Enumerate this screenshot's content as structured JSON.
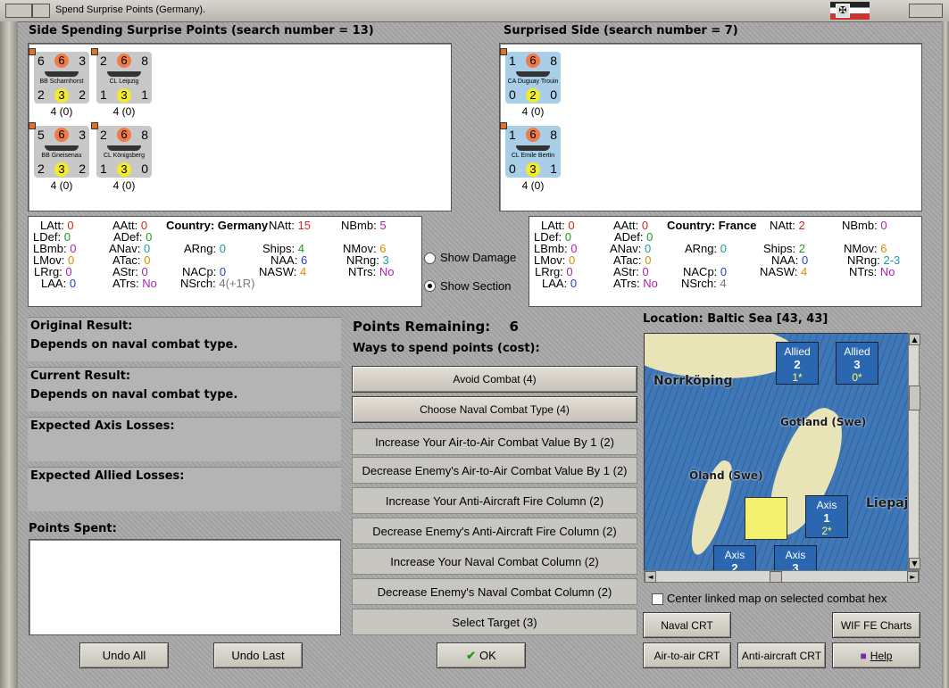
{
  "window": {
    "title": "Spend Surprise Points (Germany)."
  },
  "left_side": {
    "header": "Side Spending Surprise Points (search number = 13)",
    "counters": [
      {
        "name": "BB Scharnhorst",
        "tl": "6",
        "tc": "6",
        "tr": "3",
        "bl": "2",
        "bc": "3",
        "br": "2",
        "caption": "4 (0)"
      },
      {
        "name": "CL Leipzig",
        "tl": "2",
        "tc": "6",
        "tr": "8",
        "bl": "1",
        "bc": "3",
        "br": "1",
        "caption": "4 (0)"
      },
      {
        "name": "BB Gneisenau",
        "tl": "5",
        "tc": "6",
        "tr": "3",
        "bl": "2",
        "bc": "3",
        "br": "2",
        "caption": "4 (0)"
      },
      {
        "name": "CL Königsberg",
        "tl": "2",
        "tc": "6",
        "tr": "8",
        "bl": "1",
        "bc": "3",
        "br": "0",
        "caption": "4 (0)"
      }
    ]
  },
  "right_side": {
    "header": "Surprised Side (search number = 7)",
    "counters": [
      {
        "name": "CA Duguay Trouin",
        "tl": "1",
        "tc": "6",
        "tr": "8",
        "bl": "0",
        "bc": "2",
        "br": "0",
        "caption": "4 (0)"
      },
      {
        "name": "CL Emile Bertin",
        "tl": "1",
        "tc": "6",
        "tr": "8",
        "bl": "0",
        "bc": "3",
        "br": "1",
        "caption": "4 (0)"
      }
    ]
  },
  "stats_left": {
    "country_label": "Country:",
    "country": "Germany",
    "rows": [
      [
        "LAtt:",
        "0",
        "AAtt:",
        "0",
        "NAtt:",
        "15",
        "NBmb:",
        "5"
      ],
      [
        "LDef:",
        "0",
        "ADef:",
        "0",
        "",
        "",
        "",
        ""
      ],
      [
        "LBmb:",
        "0",
        "ANav:",
        "0",
        "ARng:",
        "0",
        "Ships:",
        "4",
        "NMov:",
        "6"
      ],
      [
        "LMov:",
        "0",
        "ATac:",
        "0",
        "NAA:",
        "6",
        "NRng:",
        "3"
      ],
      [
        "LRrg:",
        "0",
        "AStr:",
        "0",
        "NACp:",
        "0",
        "NASW:",
        "4",
        "NTrs:",
        "No"
      ],
      [
        "LAA:",
        "0",
        "ATrs:",
        "No",
        "NSrch:",
        "4(+1R)"
      ]
    ]
  },
  "stats_right": {
    "country_label": "Country:",
    "country": "France",
    "values": {
      "LAtt": "0",
      "AAtt": "0",
      "NAtt": "2",
      "NBmb": "0",
      "LDef": "0",
      "ADef": "0",
      "LBmb": "0",
      "ANav": "0",
      "ARng": "0",
      "Ships": "2",
      "NMov": "6",
      "LMov": "0",
      "ATac": "0",
      "NAA": "0",
      "NRng": "2-3",
      "LRrg": "0",
      "AStr": "0",
      "NACp": "0",
      "NASW": "4",
      "NTrs": "No",
      "LAA": "0",
      "ATrs": "No",
      "NSrch": "4"
    }
  },
  "options": {
    "show_damage": "Show Damage",
    "show_section": "Show Section"
  },
  "results": {
    "original_label": "Original Result:",
    "original_value": "Depends on naval combat type.",
    "current_label": "Current Result:",
    "current_value": "Depends on naval combat type.",
    "axis_losses": "Expected Axis Losses:",
    "allied_losses": "Expected Allied Losses:",
    "points_spent": "Points Spent:"
  },
  "spend": {
    "points_label": "Points Remaining:",
    "points_value": "6",
    "ways_label": "Ways to spend points (cost):",
    "buttons": [
      "Avoid Combat (4)",
      "Choose Naval Combat Type (4)",
      "Increase Your Air-to-Air Combat Value By 1 (2)",
      "Decrease Enemy's Air-to-Air Combat Value By 1 (2)",
      "Increase Your Anti-Aircraft Fire Column (2)",
      "Decrease Enemy's Anti-Aircraft Fire Column (2)",
      "Increase Your Naval Combat Column (2)",
      "Decrease Enemy's Naval Combat Column (2)",
      "Select Target (3)"
    ]
  },
  "map": {
    "location": "Location: Baltic Sea [43, 43]",
    "labels": [
      "Norrköping",
      "Gotland (Swe)",
      "Öland (Swe)",
      "Liepaj"
    ],
    "units": [
      {
        "side": "Allied",
        "strength": "2",
        "extra": "1*"
      },
      {
        "side": "Allied",
        "strength": "3",
        "extra": "0*"
      },
      {
        "side": "Axis",
        "strength": "1",
        "extra": "2*"
      },
      {
        "side": "Axis",
        "strength": "2",
        "extra": ""
      },
      {
        "side": "Axis",
        "strength": "3",
        "extra": ""
      }
    ],
    "center_linked": "Center linked map on selected combat hex"
  },
  "bottom_buttons": {
    "undo_all": "Undo All",
    "undo_last": "Undo Last",
    "ok": "OK",
    "naval_crt": "Naval CRT",
    "wif_charts": "WIF FE Charts",
    "air_crt": "Air-to-air CRT",
    "aa_crt": "Anti-aircraft CRT",
    "help": "Help"
  },
  "colors": {
    "red": "#dd2222",
    "green": "#1f9a1f",
    "teal": "#1e9aa3",
    "orange": "#e08a00",
    "purple": "#b21fb2",
    "blue": "#1f3fd0",
    "gray": "#777777"
  }
}
